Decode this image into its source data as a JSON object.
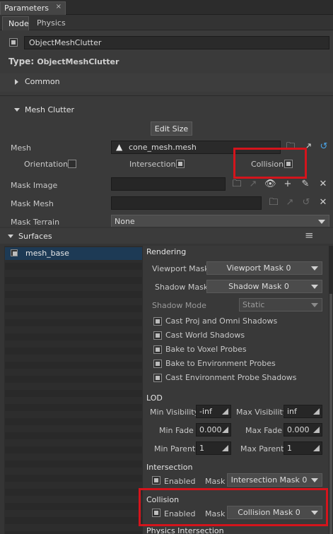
{
  "window": {
    "tab_title": "Parameters",
    "close": "×"
  },
  "subtabs": [
    "Node",
    "Physics"
  ],
  "node": {
    "name": "ObjectMeshClutter",
    "type_label": "Type:",
    "type_value": "ObjectMeshClutter"
  },
  "sections": {
    "common": "Common",
    "mesh_clutter": "Mesh Clutter",
    "surfaces": "Surfaces"
  },
  "mesh_clutter": {
    "edit_size": "Edit Size",
    "mesh_label": "Mesh",
    "mesh_value": "cone_mesh.mesh",
    "orientation": "Orientation",
    "intersection": "Intersection",
    "collision": "Collision",
    "mask_image": "Mask Image",
    "mask_mesh": "Mask Mesh",
    "mask_terrain": "Mask Terrain",
    "mask_terrain_value": "None"
  },
  "surfaces_list": [
    "mesh_base"
  ],
  "rendering": {
    "title": "Rendering",
    "viewport_mask_label": "Viewport Mask",
    "viewport_mask_value": "Viewport Mask 0",
    "shadow_mask_label": "Shadow Mask",
    "shadow_mask_value": "Shadow Mask 0",
    "shadow_mode_label": "Shadow Mode",
    "shadow_mode_value": "Static",
    "options": [
      "Cast Proj and Omni Shadows",
      "Cast World Shadows",
      "Bake to Voxel Probes",
      "Bake to Environment Probes",
      "Cast Environment Probe Shadows"
    ]
  },
  "lod": {
    "title": "LOD",
    "min_visibility_label": "Min Visibility",
    "min_visibility": "-inf",
    "max_visibility_label": "Max Visibility",
    "max_visibility": "inf",
    "min_fade_label": "Min Fade",
    "min_fade": "0.000",
    "max_fade_label": "Max Fade",
    "max_fade": "0.000",
    "min_parent_label": "Min Parent",
    "min_parent": "1",
    "max_parent_label": "Max Parent",
    "max_parent": "1"
  },
  "intersection": {
    "title": "Intersection",
    "enabled": "Enabled",
    "mask_label": "Mask",
    "mask_value": "Intersection Mask 0"
  },
  "collision": {
    "title": "Collision",
    "enabled": "Enabled",
    "mask_label": "Mask",
    "mask_value": "Collision Mask 0"
  },
  "physics_intersection": {
    "title": "Physics Intersection"
  },
  "colors": {
    "highlight": "#d4141c",
    "selected_row": "#1d3a55"
  }
}
